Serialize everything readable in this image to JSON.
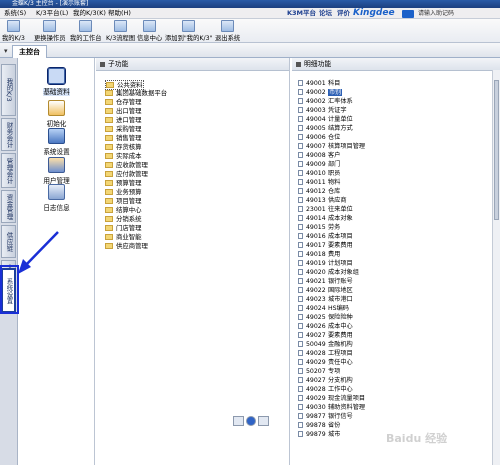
{
  "window": {
    "title": "金蝶K/3 主控台 - [演示账套]"
  },
  "menubar": {
    "items": [
      "系统(S)",
      "K/3平台(L)",
      "我的K/3(K)",
      "帮助(H)"
    ],
    "links": [
      "K3M平台",
      "论坛",
      "评价"
    ],
    "brand": "Kingdee",
    "search_placeholder": "请输入助记码"
  },
  "toolbar": {
    "items": [
      "我的K/3",
      "更换操作员",
      "我的工作台",
      "K/3流程图",
      "信息中心",
      "添加到\"我的K/3\"",
      "退出系统"
    ]
  },
  "tab": {
    "label": "主控台"
  },
  "left_tabs": [
    "我的K/3",
    "财务会计",
    "管理会计",
    "资金管理",
    "供应链",
    "人力资源",
    "系统设置"
  ],
  "icon_items": [
    "基础资料",
    "初始化",
    "系统设置",
    "用户管理",
    "日志信息"
  ],
  "sub_panel": {
    "title": "子功能",
    "items": [
      "公共资料",
      "集团基础数据平台",
      "仓存管理",
      "出口管理",
      "进口管理",
      "采购管理",
      "销售管理",
      "存货核算",
      "实际成本",
      "应收款管理",
      "应付款管理",
      "预算管理",
      "业务预算",
      "项目管理",
      "结算中心",
      "分销系统",
      "门店管理",
      "商业智能",
      "供应商管理"
    ]
  },
  "detail_panel": {
    "title": "明细功能",
    "selected_index": 1,
    "items": [
      {
        "code": "49001",
        "name": "科目"
      },
      {
        "code": "49002",
        "name": "币别"
      },
      {
        "code": "49002",
        "name": "汇率体系"
      },
      {
        "code": "49003",
        "name": "凭证字"
      },
      {
        "code": "49004",
        "name": "计量单位"
      },
      {
        "code": "49005",
        "name": "结算方式"
      },
      {
        "code": "49006",
        "name": "仓位"
      },
      {
        "code": "49007",
        "name": "核算项目管理"
      },
      {
        "code": "49008",
        "name": "客户"
      },
      {
        "code": "49009",
        "name": "部门"
      },
      {
        "code": "49010",
        "name": "职员"
      },
      {
        "code": "49011",
        "name": "物料"
      },
      {
        "code": "49012",
        "name": "仓库"
      },
      {
        "code": "49013",
        "name": "供应商"
      },
      {
        "code": "23001",
        "name": "往来单位"
      },
      {
        "code": "49014",
        "name": "成本对象"
      },
      {
        "code": "49015",
        "name": "劳务"
      },
      {
        "code": "49016",
        "name": "成本项目"
      },
      {
        "code": "49017",
        "name": "要素费用"
      },
      {
        "code": "49018",
        "name": "费用"
      },
      {
        "code": "49019",
        "name": "计划项目"
      },
      {
        "code": "49020",
        "name": "成本对象组"
      },
      {
        "code": "49021",
        "name": "银行账号"
      },
      {
        "code": "49022",
        "name": "国际地区"
      },
      {
        "code": "49023",
        "name": "城市港口"
      },
      {
        "code": "49024",
        "name": "HS编码"
      },
      {
        "code": "49025",
        "name": "保险险种"
      },
      {
        "code": "49026",
        "name": "成本中心"
      },
      {
        "code": "49027",
        "name": "要素费用"
      },
      {
        "code": "50049",
        "name": "金融机构"
      },
      {
        "code": "49028",
        "name": "工程项目"
      },
      {
        "code": "49029",
        "name": "责任中心"
      },
      {
        "code": "50207",
        "name": "专项"
      },
      {
        "code": "49027",
        "name": "分支机构"
      },
      {
        "code": "49028",
        "name": "工作中心"
      },
      {
        "code": "49029",
        "name": "现金流量项目"
      },
      {
        "code": "49030",
        "name": "辅助资料管理"
      },
      {
        "code": "99877",
        "name": "银行信号"
      },
      {
        "code": "99878",
        "name": "省份"
      },
      {
        "code": "99879",
        "name": "城市"
      }
    ]
  },
  "watermark": "Baidu 经验",
  "colors": {
    "title_bar": "#1c3f80",
    "selection": "#2b5fb4",
    "folder": "#f3d674",
    "annotation_arrow": "#1a2fd6"
  }
}
